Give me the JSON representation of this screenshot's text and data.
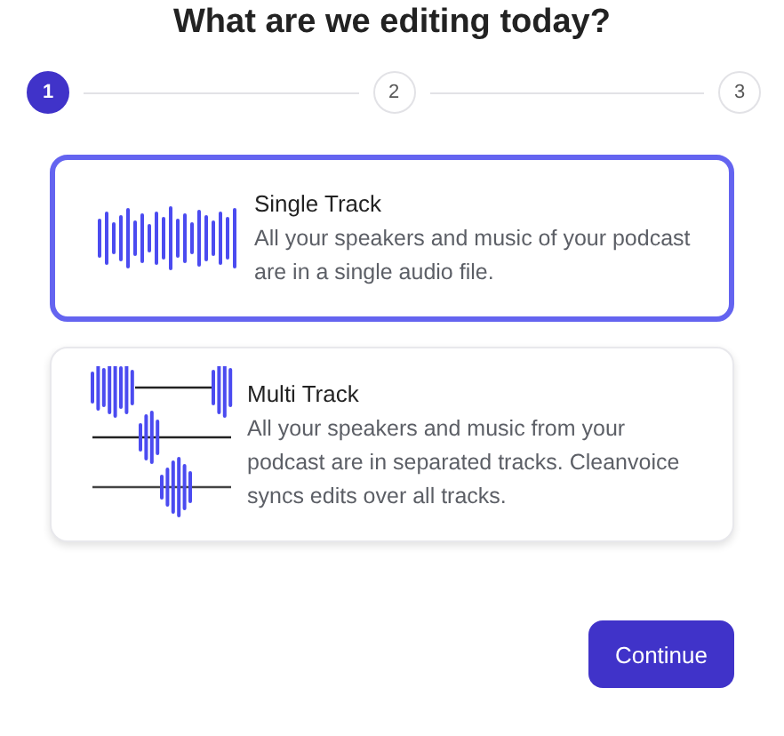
{
  "title": "What are we editing today?",
  "steps": [
    {
      "label": "1",
      "selected": true
    },
    {
      "label": "2",
      "selected": false
    },
    {
      "label": "3",
      "selected": false
    }
  ],
  "options": [
    {
      "kind": "single",
      "title": "Single Track",
      "description": "All your speakers and music of your podcast are in a single audio file.",
      "selected": true
    },
    {
      "kind": "multi",
      "title": "Multi Track",
      "description": "All your speakers and music from your podcast are in separated tracks. Cleanvoice syncs edits over all tracks.",
      "selected": false
    }
  ],
  "button": "Continue"
}
